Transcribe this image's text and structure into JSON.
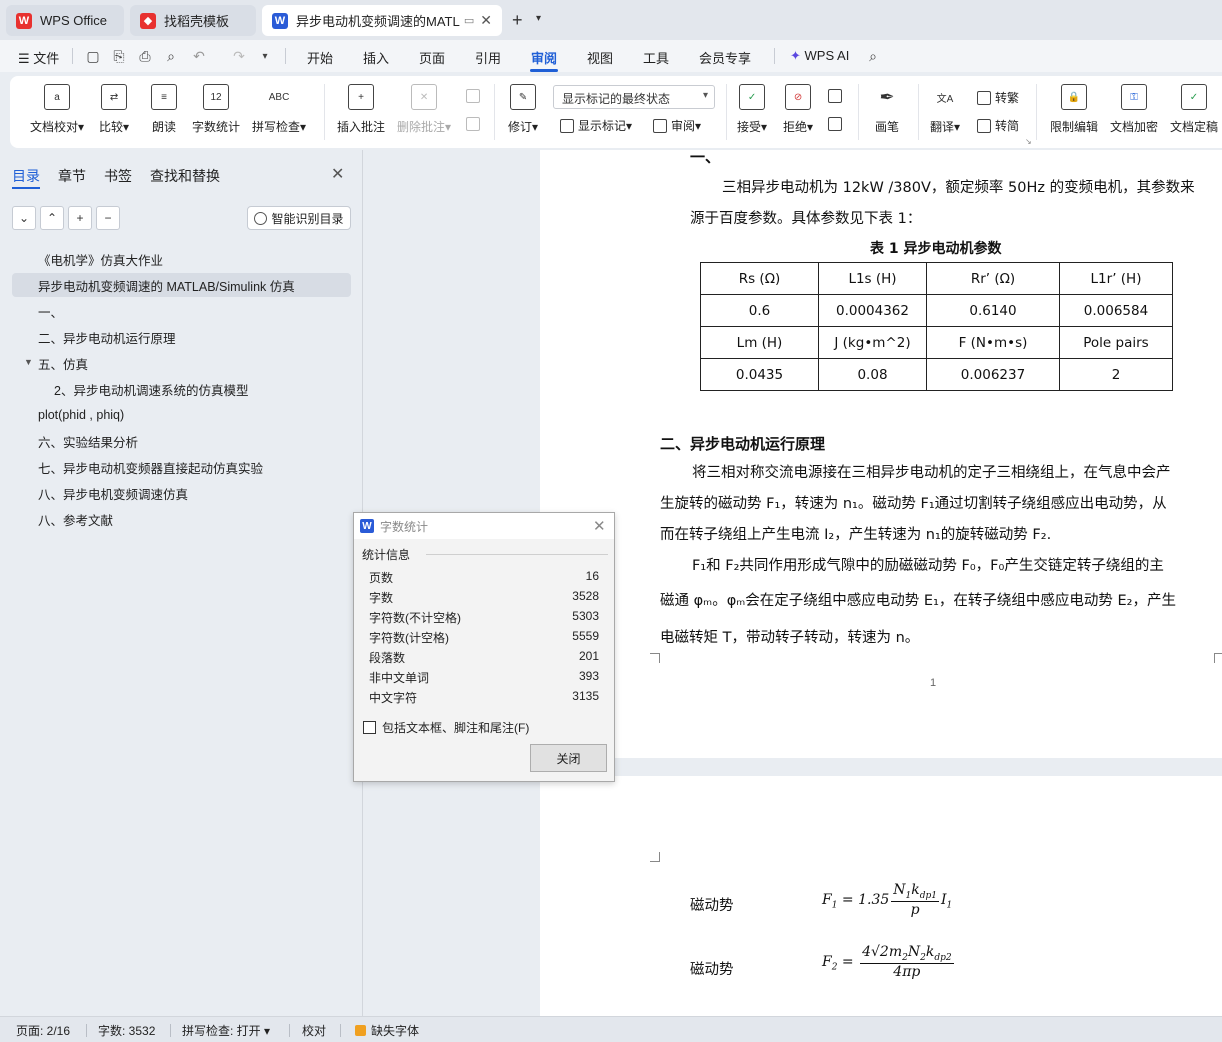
{
  "tabs": [
    {
      "label": "WPS Office",
      "icon": "wps-logo-icon",
      "color": "#e8312f"
    },
    {
      "label": "找稻壳模板",
      "icon": "docer-logo-icon",
      "color": "#e8312f"
    },
    {
      "label": "异步电动机变频调速的MATLA",
      "icon": "wps-writer-icon",
      "color": "#2a5bd7"
    }
  ],
  "menu": {
    "file": "文件",
    "items": [
      "开始",
      "插入",
      "页面",
      "引用",
      "审阅",
      "视图",
      "工具",
      "会员专享"
    ],
    "active": "审阅",
    "wps_ai": "WPS AI"
  },
  "ribbon": {
    "buttons": [
      "文档校对",
      "比较",
      "朗读",
      "字数统计",
      "拼写检查",
      "插入批注",
      "删除批注"
    ],
    "word_count_badge": "12",
    "spell_badge": "ABC",
    "track_dropdown": "显示标记的最终状态",
    "revise": "修订",
    "show_markup": "显示标记",
    "review": "审阅",
    "accept": "接受",
    "reject": "拒绝",
    "pen": "画笔",
    "translate": "翻译",
    "to_traditional": "转繁",
    "to_simplified": "转简",
    "restrict_edit": "限制编辑",
    "encrypt": "文档加密",
    "finalize": "文档定稿"
  },
  "nav": {
    "tabs": [
      "目录",
      "章节",
      "书签",
      "查找和替换"
    ],
    "active": "目录",
    "smart_toc": "智能识别目录",
    "toc": [
      {
        "label": "《电机学》仿真大作业",
        "level": 1,
        "selected": false,
        "expanded": null
      },
      {
        "label": "异步电动机变频调速的 MATLAB/Simulink 仿真",
        "level": 1,
        "selected": true,
        "expanded": null
      },
      {
        "label": "一、",
        "level": 2,
        "selected": false,
        "expanded": null
      },
      {
        "label": "二、异步电动机运行原理",
        "level": 2,
        "selected": false,
        "expanded": null
      },
      {
        "label": "五、仿真",
        "level": 2,
        "selected": false,
        "expanded": true
      },
      {
        "label": "2、异步电动机调速系统的仿真模型",
        "level": 3,
        "selected": false,
        "expanded": null
      },
      {
        "label": "plot(phid , phiq)",
        "level": 2,
        "selected": false,
        "expanded": null
      },
      {
        "label": "六、实验结果分析",
        "level": 2,
        "selected": false,
        "expanded": null
      },
      {
        "label": "七、异步电动机变频器直接起动仿真实验",
        "level": 2,
        "selected": false,
        "expanded": null
      },
      {
        "label": "八、异步电机变频调速仿真",
        "level": 2,
        "selected": false,
        "expanded": null
      },
      {
        "label": "八、参考文献",
        "level": 2,
        "selected": false,
        "expanded": null
      }
    ]
  },
  "document": {
    "heading1": "一、",
    "para1_line1": "三相异步电动机为 12kW /380V，额定频率 50Hz 的变频电机，其参数来",
    "para1_line2": "源于百度参数。具体参数见下表 1：",
    "table_caption": "表 1  异步电动机参数",
    "table": [
      [
        "Rs (Ω)",
        "L1s (H)",
        "Rr’ (Ω)",
        "L1r’ (H)"
      ],
      [
        "0.6",
        "0.0004362",
        "0.6140",
        "0.006584"
      ],
      [
        "Lm (H)",
        "J (kg•m^2)",
        "F (N•m•s)",
        "Pole pairs"
      ],
      [
        "0.0435",
        "0.08",
        "0.006237",
        "2"
      ]
    ],
    "heading2": "二、异步电动机运行原理",
    "para2_line1": "将三相对称交流电源接在三相异步电动机的定子三相绕组上，在气息中会产",
    "para2_line2": "生旋转的磁动势 F₁，转速为 n₁。磁动势 F₁通过切割转子绕组感应出电动势，从",
    "para2_line3": "而在转子绕组上产生电流 I₂，产生转速为 n₁的旋转磁动势 F₂.",
    "para3_line1": "F₁和 F₂共同作用形成气隙中的励磁磁动势 F₀，F₀产生交链定转子绕组的主",
    "para3_line2": "磁通 φₘ。φₘ会在定子绕组中感应电动势 E₁，在转子绕组中感应电动势 E₂，产生",
    "para3_line3": "电磁转矩 T，带动转子转动，转速为 n。",
    "page_number": "1",
    "eq_label1": "磁动势",
    "eq_label2": "磁动势"
  },
  "dialog": {
    "title": "字数统计",
    "group": "统计信息",
    "stats": [
      {
        "label": "页数",
        "value": "16"
      },
      {
        "label": "字数",
        "value": "3528"
      },
      {
        "label": "字符数(不计空格)",
        "value": "5303"
      },
      {
        "label": "字符数(计空格)",
        "value": "5559"
      },
      {
        "label": "段落数",
        "value": "201"
      },
      {
        "label": "非中文单词",
        "value": "393"
      },
      {
        "label": "中文字符",
        "value": "3135"
      }
    ],
    "checkbox": "包括文本框、脚注和尾注(F)",
    "close": "关闭"
  },
  "status": {
    "page": "页面: 2/16",
    "words": "字数: 3532",
    "spell": "拼写检查: 打开",
    "proof": "校对",
    "missing_font": "缺失字体"
  },
  "colors": {
    "accent": "#1f5fd6",
    "wps_red": "#e8312f",
    "writer_blue": "#2a5bd7"
  }
}
